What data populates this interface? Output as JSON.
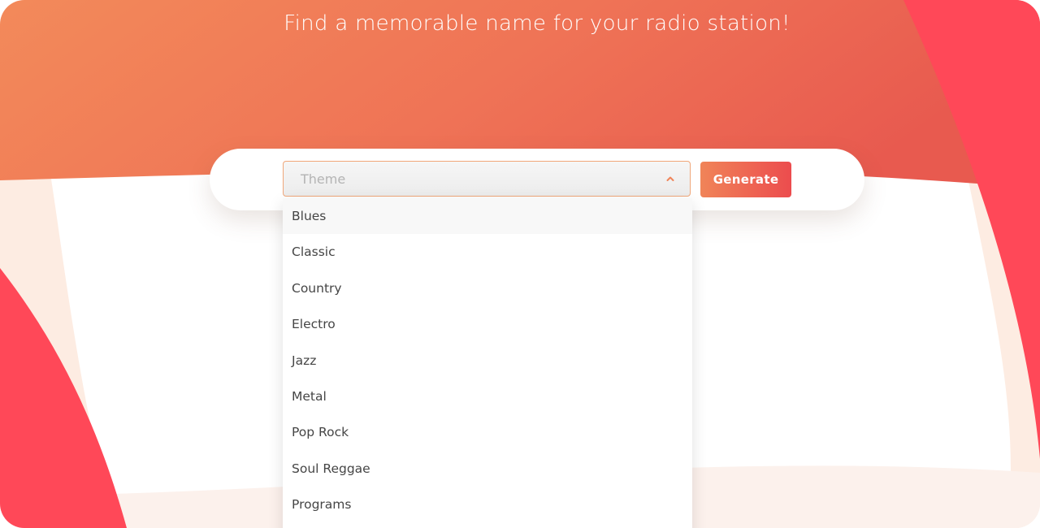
{
  "page": {
    "headline": "Find a memorable name for your radio station!"
  },
  "form": {
    "theme_placeholder": "Theme",
    "generate_label": "Generate"
  },
  "dropdown": {
    "options": [
      "Blues",
      "Classic",
      "Country",
      "Electro",
      "Jazz",
      "Metal",
      "Pop Rock",
      "Soul Reggae",
      "Programs"
    ],
    "highlighted": "Blues"
  },
  "colors": {
    "accent_orange": "#f08458",
    "accent_red": "#ec4c4e",
    "coral": "#ff4858",
    "peach": "#fdeee4",
    "select_border": "#f0a77a"
  },
  "icons": {
    "select_toggle": "chevron-up-icon"
  }
}
